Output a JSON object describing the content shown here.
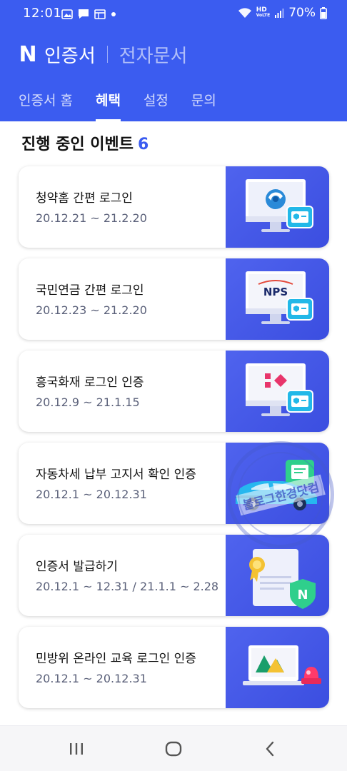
{
  "status_bar": {
    "time": "12:01",
    "battery": "70%",
    "network": "HD",
    "network_sub": "VoLTE"
  },
  "header": {
    "brand_logo": "N",
    "app_title": "인증서",
    "app_subtitle": "전자문서",
    "tabs": [
      {
        "label": "인증서 홈",
        "active": false
      },
      {
        "label": "혜택",
        "active": true
      },
      {
        "label": "설정",
        "active": false
      },
      {
        "label": "문의",
        "active": false
      }
    ]
  },
  "events": {
    "title": "진행 중인 이벤트",
    "count": "6",
    "items": [
      {
        "title": "청약홈 간편 로그인",
        "date": "20.12.21 ~ 21.2.20",
        "thumb": "monitor-cheongyak"
      },
      {
        "title": "국민연금 간편 로그인",
        "date": "20.12.23 ~ 21.2.20",
        "thumb": "monitor-nps",
        "thumb_text": "NPS"
      },
      {
        "title": "흥국화재 로그인 인증",
        "date": "20.12.9 ~ 21.1.15",
        "thumb": "monitor-heungkuk"
      },
      {
        "title": "자동차세 납부 고지서 확인 인증",
        "date": "20.12.1 ~ 20.12.31",
        "thumb": "car-tax"
      },
      {
        "title": "인증서 발급하기",
        "date": "20.12.1 ~ 12.31 / 21.1.1 ~ 2.28",
        "thumb": "certificate-issue"
      },
      {
        "title": "민방위 온라인 교육 로그인 인증",
        "date": "20.12.1 ~ 20.12.31",
        "thumb": "civil-defense"
      }
    ]
  },
  "watermark": {
    "text": "블로그한경닷컴"
  },
  "nav": {
    "recents": "recents-icon",
    "home": "home-icon",
    "back": "back-icon"
  },
  "colors": {
    "brand": "#3b5cf0",
    "thumb_bg": "#4b5eea",
    "date_text": "#5a6079"
  }
}
